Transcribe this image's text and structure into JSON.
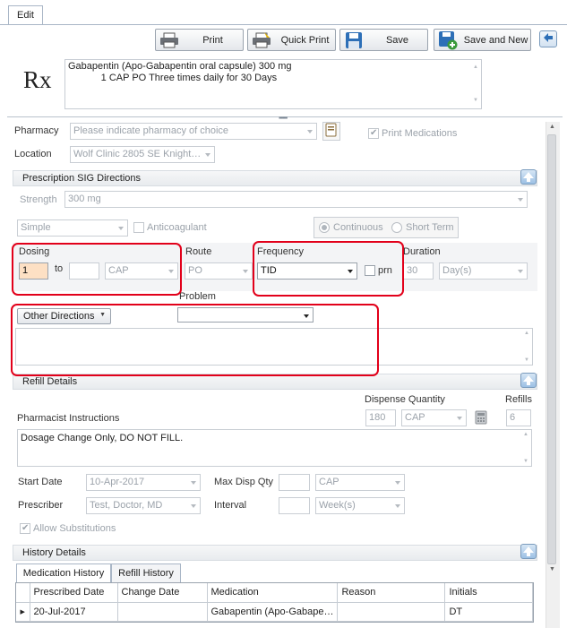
{
  "tabs": {
    "edit": "Edit"
  },
  "toolbar": {
    "print": "Print",
    "quick_print": "Quick Print",
    "save": "Save",
    "save_and_new": "Save and New"
  },
  "rx": {
    "symbol": "Rx",
    "text": "Gabapentin (Apo-Gabapentin oral capsule) 300 mg\n            1 CAP PO Three times daily for 30 Days"
  },
  "pharmacy": {
    "label": "Pharmacy",
    "placeholder": "Please indicate pharmacy of choice",
    "print_medications": "Print Medications"
  },
  "location": {
    "label": "Location",
    "value": "Wolf Clinic 2805 SE Knight…"
  },
  "sig": {
    "title": "Prescription SIG Directions",
    "strength_label": "Strength",
    "strength_value": "300 mg",
    "mode_value": "Simple",
    "anticoagulant": "Anticoagulant",
    "continuous": "Continuous",
    "short_term": "Short Term",
    "dosing_label": "Dosing",
    "dose_from": "1",
    "to_label": "to",
    "dose_to": "",
    "dose_unit": "CAP",
    "route_label": "Route",
    "route_value": "PO",
    "frequency_label": "Frequency",
    "frequency_value": "TID",
    "prn_label": "prn",
    "duration_label": "Duration",
    "duration_value": "30",
    "duration_unit": "Day(s)",
    "problem_label": "Problem",
    "problem_value": "",
    "other_directions": "Other Directions",
    "other_text": ""
  },
  "refill": {
    "title": "Refill Details",
    "dispense_quantity_label": "Dispense Quantity",
    "refills_label": "Refills",
    "pharmacist_instructions_label": "Pharmacist Instructions",
    "dispense_qty": "180",
    "dispense_unit": "CAP",
    "refills": "6",
    "instructions": "Dosage Change Only, DO NOT FILL.",
    "start_date_label": "Start Date",
    "start_date": "10-Apr-2017",
    "max_disp_qty_label": "Max Disp Qty",
    "max_disp_qty": "",
    "max_disp_unit": "CAP",
    "prescriber_label": "Prescriber",
    "prescriber": "Test, Doctor, MD",
    "interval_label": "Interval",
    "interval": "",
    "interval_unit": "Week(s)",
    "allow_substitutions": "Allow Substitutions"
  },
  "history": {
    "title": "History Details",
    "tabs": [
      "Medication History",
      "Refill History"
    ],
    "columns": [
      "Prescribed Date",
      "Change Date",
      "Medication",
      "Reason",
      "Initials"
    ],
    "rows": [
      {
        "prescribed": "20-Jul-2017",
        "change": "",
        "medication": "Gabapentin (Apo-Gabape…",
        "reason": "",
        "initials": "DT"
      }
    ]
  },
  "colors": {
    "highlight": "#e2001a",
    "accent": "#3a78c2"
  }
}
